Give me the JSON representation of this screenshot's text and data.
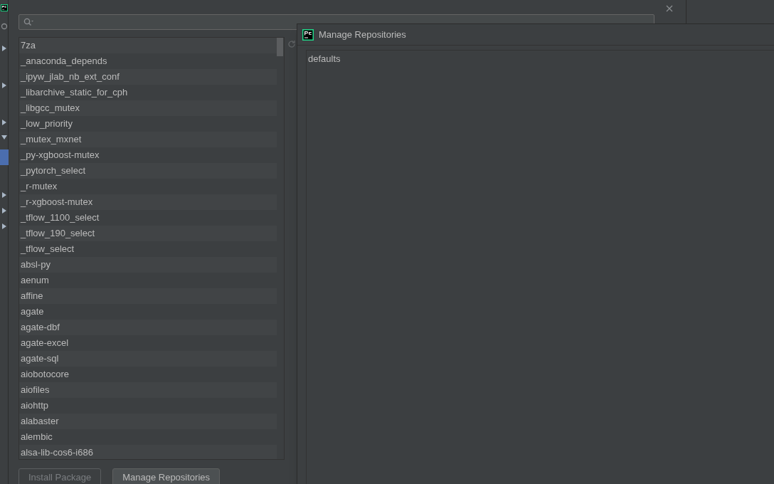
{
  "packages_dialog": {
    "packages": [
      {
        "name": "7za",
        "selected": false
      },
      {
        "name": "_anaconda_depends",
        "selected": false
      },
      {
        "name": "_ipyw_jlab_nb_ext_conf",
        "selected": false
      },
      {
        "name": "_libarchive_static_for_cph",
        "selected": false
      },
      {
        "name": "_libgcc_mutex",
        "selected": false
      },
      {
        "name": "_low_priority",
        "selected": false
      },
      {
        "name": "_mutex_mxnet",
        "selected": false
      },
      {
        "name": "_py-xgboost-mutex",
        "selected": false
      },
      {
        "name": "_pytorch_select",
        "selected": false
      },
      {
        "name": "_r-mutex",
        "selected": false
      },
      {
        "name": "_r-xgboost-mutex",
        "selected": false
      },
      {
        "name": "_tflow_1100_select",
        "selected": false
      },
      {
        "name": "_tflow_190_select",
        "selected": false
      },
      {
        "name": "_tflow_select",
        "selected": false
      },
      {
        "name": "absl-py",
        "selected": false
      },
      {
        "name": "aenum",
        "selected": false
      },
      {
        "name": "affine",
        "selected": false
      },
      {
        "name": "agate",
        "selected": false
      },
      {
        "name": "agate-dbf",
        "selected": false
      },
      {
        "name": "agate-excel",
        "selected": false
      },
      {
        "name": "agate-sql",
        "selected": false
      },
      {
        "name": "aiobotocore",
        "selected": false
      },
      {
        "name": "aiofiles",
        "selected": false
      },
      {
        "name": "aiohttp",
        "selected": false
      },
      {
        "name": "alabaster",
        "selected": false
      },
      {
        "name": "alembic",
        "selected": false
      },
      {
        "name": "alsa-lib-cos6-i686",
        "selected": false
      }
    ],
    "buttons": [
      {
        "label": "Install Package",
        "disabled": true
      },
      {
        "label": "Manage Repositories",
        "disabled": false
      }
    ]
  },
  "repositories_dialog": {
    "title": "Manage Repositories",
    "repositories": [
      "defaults"
    ]
  }
}
